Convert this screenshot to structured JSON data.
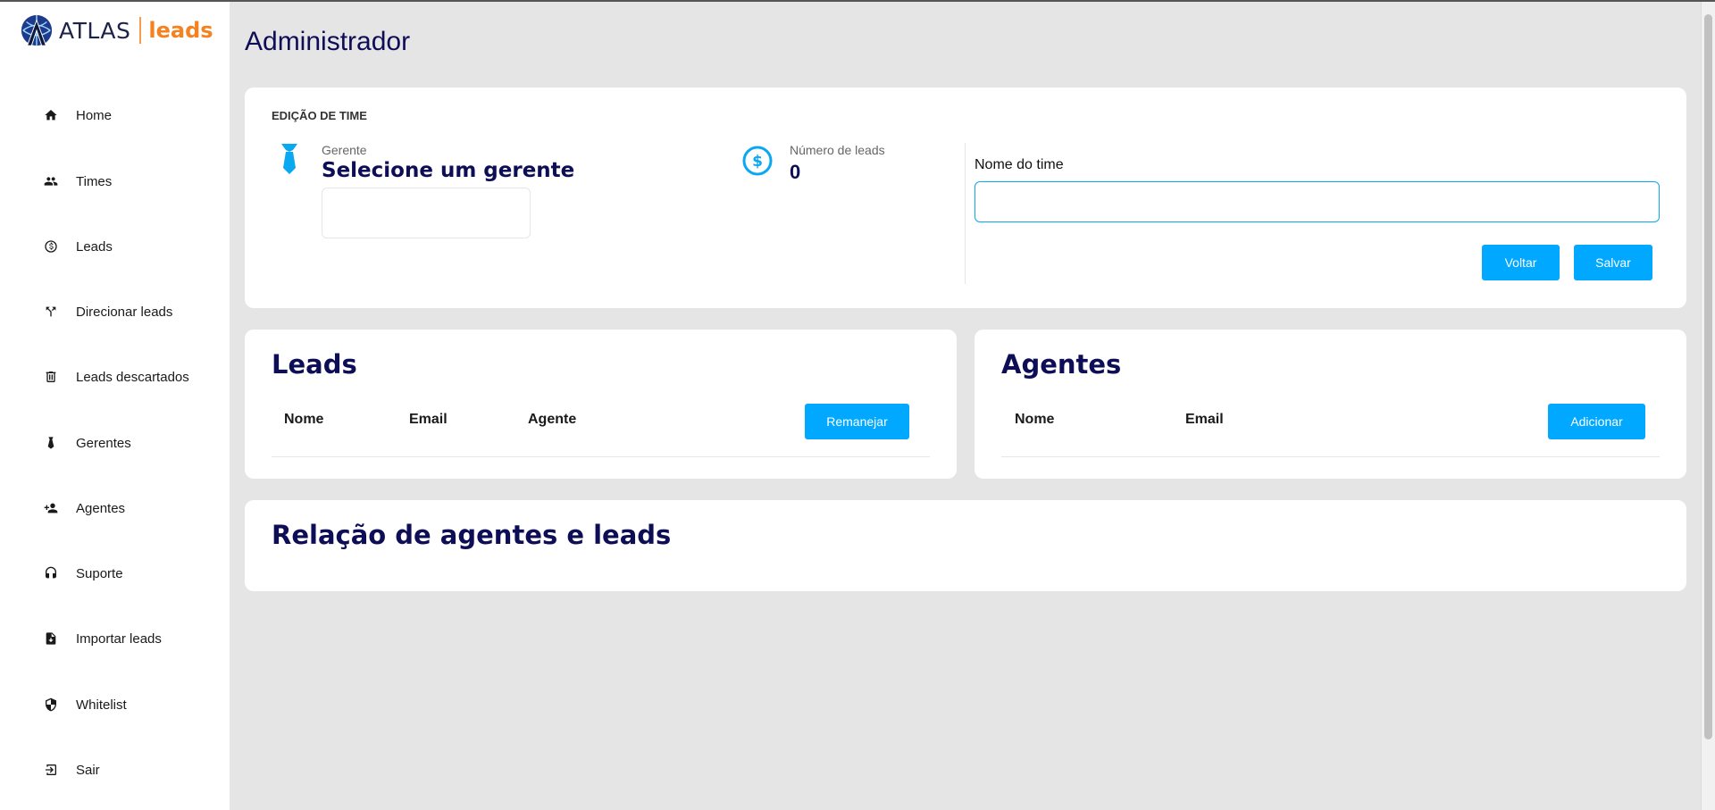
{
  "brand": {
    "name": "ATLAS",
    "product": "leads",
    "accent": "#f58220",
    "primary": "#0e0e57",
    "button": "#00a8ff"
  },
  "sidebar": {
    "items": [
      {
        "label": "Home",
        "icon": "home-icon"
      },
      {
        "label": "Times",
        "icon": "people-icon"
      },
      {
        "label": "Leads",
        "icon": "dollar-circle-icon"
      },
      {
        "label": "Direcionar leads",
        "icon": "fork-icon"
      },
      {
        "label": "Leads descartados",
        "icon": "trash-icon"
      },
      {
        "label": "Gerentes",
        "icon": "tie-icon"
      },
      {
        "label": "Agentes",
        "icon": "add-person-icon"
      },
      {
        "label": "Suporte",
        "icon": "headset-icon"
      },
      {
        "label": "Importar leads",
        "icon": "file-import-icon"
      },
      {
        "label": "Whitelist",
        "icon": "shield-icon"
      },
      {
        "label": "Sair",
        "icon": "logout-icon"
      }
    ]
  },
  "page": {
    "title": "Administrador"
  },
  "edit_team": {
    "heading": "EDIÇÃO DE TIME",
    "manager_label": "Gerente",
    "manager_value": "Selecione um gerente",
    "leads_count_label": "Número de leads",
    "leads_count_value": "0",
    "team_name_label": "Nome do time",
    "team_name_value": "",
    "back_button": "Voltar",
    "save_button": "Salvar"
  },
  "leads_card": {
    "title": "Leads",
    "columns": [
      "Nome",
      "Email",
      "Agente"
    ],
    "action_button": "Remanejar"
  },
  "agents_card": {
    "title": "Agentes",
    "columns": [
      "Nome",
      "Email"
    ],
    "action_button": "Adicionar"
  },
  "relation_card": {
    "title": "Relação de agentes e leads"
  }
}
